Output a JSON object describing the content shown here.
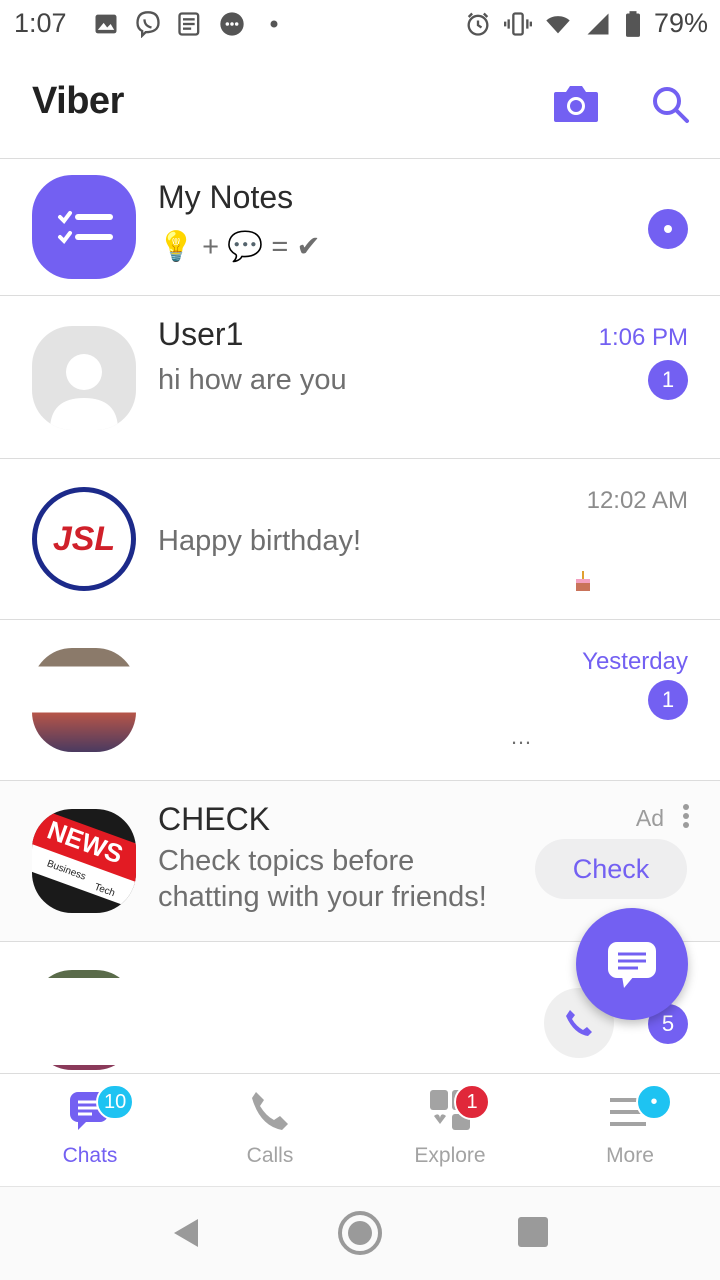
{
  "status_bar": {
    "time": "1:07",
    "battery": "79%",
    "left_icons": [
      "image-icon",
      "viber-icon",
      "news-icon",
      "message-icon",
      "dot-icon"
    ],
    "right_icons": [
      "alarm-icon",
      "vibrate-icon",
      "wifi-icon",
      "signal-icon",
      "battery-icon"
    ]
  },
  "app_bar": {
    "title": "Viber",
    "camera_icon": "camera-icon",
    "search_icon": "search-icon"
  },
  "chats": [
    {
      "name": "My Notes",
      "preview": "💡 + 💬 = ✔",
      "time": "",
      "badge": "",
      "avatar": "notes-icon"
    },
    {
      "name": "User1",
      "preview": "hi how are you",
      "time": "1:06 PM",
      "badge": "1",
      "avatar": "default-avatar"
    },
    {
      "name": "",
      "preview": "Happy birthday!",
      "time": "12:02 AM",
      "badge": "",
      "avatar": "jsl-logo",
      "avatar_text": "JSL"
    },
    {
      "name": "",
      "preview": "…",
      "time": "Yesterday",
      "badge": "1",
      "avatar": "group-photo"
    },
    {
      "name": "CHECK",
      "preview_line1": "Check topics before",
      "preview_line2": "chatting with your friends!",
      "ad_label": "Ad",
      "cta": "Check",
      "avatar": "news-logo",
      "avatar_text": "NEWS",
      "avatar_sub1": "Business",
      "avatar_sub2": "Tech"
    },
    {
      "name": "",
      "preview": "",
      "time": "",
      "badge": "5",
      "avatar": "photo"
    }
  ],
  "bottom_nav": [
    {
      "label": "Chats",
      "badge": "10",
      "active": true
    },
    {
      "label": "Calls",
      "badge": ""
    },
    {
      "label": "Explore",
      "badge": "1"
    },
    {
      "label": "More",
      "badge": "•"
    }
  ],
  "colors": {
    "accent": "#7360f2",
    "badge_blue": "#1ec3f2",
    "badge_red": "#e0283a",
    "divider": "#dcdcdc"
  }
}
